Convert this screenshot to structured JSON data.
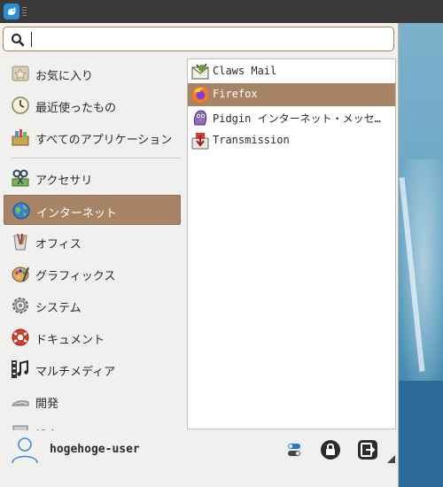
{
  "panel": {
    "logo_icon": "xfce-mouse-icon"
  },
  "search": {
    "value": "",
    "placeholder": ""
  },
  "categories": [
    {
      "label": "お気に入り",
      "icon": "favorites-icon"
    },
    {
      "label": "最近使ったもの",
      "icon": "recent-clock-icon"
    },
    {
      "label": "すべてのアプリケーション",
      "icon": "all-apps-icon"
    },
    {
      "label": "アクセサリ",
      "icon": "accessories-icon"
    },
    {
      "label": "インターネット",
      "icon": "internet-globe-icon",
      "selected": true
    },
    {
      "label": "オフィス",
      "icon": "office-icon"
    },
    {
      "label": "グラフィックス",
      "icon": "graphics-palette-icon"
    },
    {
      "label": "システム",
      "icon": "system-gear-icon"
    },
    {
      "label": "ドキュメント",
      "icon": "documentation-lifebuoy-icon"
    },
    {
      "label": "マルチメディア",
      "icon": "multimedia-icon"
    },
    {
      "label": "開発",
      "icon": "development-icon"
    },
    {
      "label": "設定",
      "icon": "settings-icon"
    }
  ],
  "apps": [
    {
      "label": "Claws Mail",
      "icon": "claws-mail-icon"
    },
    {
      "label": "Firefox",
      "icon": "firefox-icon",
      "selected": true
    },
    {
      "label": "Pidgin インターネット・メッセンジャー",
      "icon": "pidgin-icon"
    },
    {
      "label": "Transmission",
      "icon": "transmission-icon"
    }
  ],
  "footer": {
    "username": "hogehoge-user",
    "settings_icon": "settings-toggle-icon",
    "lock_icon": "lock-icon",
    "logout_icon": "logout-icon"
  },
  "colors": {
    "selection": "#a88467",
    "panel": "#3a3a3a",
    "search_border": "#a8845c"
  }
}
